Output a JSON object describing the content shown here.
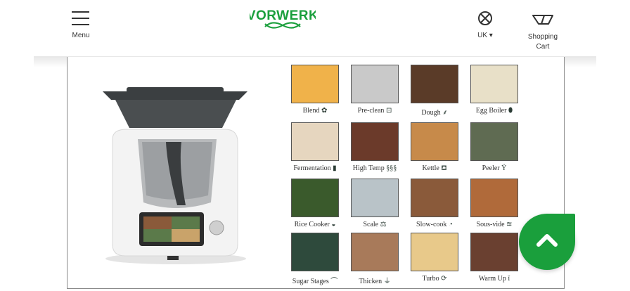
{
  "header": {
    "menu_label": "Menu",
    "logo_text": "VORWERK",
    "country_label": "UK ▾",
    "cart_label_line1": "Shopping",
    "cart_label_line2": "Cart"
  },
  "colors": {
    "brand_green": "#1a9f3c"
  },
  "tiles": [
    {
      "label": "Blend",
      "icon": "blend-icon",
      "glyph": "✿",
      "bg": "#f0b24a"
    },
    {
      "label": "Pre-clean",
      "icon": "pre-clean-icon",
      "glyph": "⊡",
      "bg": "#c9c9c9"
    },
    {
      "label": "Dough",
      "icon": "dough-icon",
      "glyph": "⸙",
      "bg": "#5a3b28"
    },
    {
      "label": "Egg Boiler",
      "icon": "egg-boiler-icon",
      "glyph": "⬮",
      "bg": "#e8e0c8"
    },
    {
      "label": "Fermentation",
      "icon": "fermentation-icon",
      "glyph": "▮",
      "bg": "#e6d6bf"
    },
    {
      "label": "High Temp",
      "icon": "high-temp-icon",
      "glyph": "§§§",
      "bg": "#6b3a2a"
    },
    {
      "label": "Kettle",
      "icon": "kettle-icon",
      "glyph": "⛾",
      "bg": "#c78a4a"
    },
    {
      "label": "Peeler",
      "icon": "peeler-icon",
      "glyph": "Ÿ",
      "bg": "#5f6b52"
    },
    {
      "label": "Rice Cooker",
      "icon": "rice-cooker-icon",
      "glyph": "◒",
      "bg": "#3a5a2c"
    },
    {
      "label": "Scale",
      "icon": "scale-icon",
      "glyph": "⚖",
      "bg": "#b9c3c8"
    },
    {
      "label": "Slow-cook",
      "icon": "slow-cook-icon",
      "glyph": "◔",
      "bg": "#8a5a3a"
    },
    {
      "label": "Sous-vide",
      "icon": "sous-vide-icon",
      "glyph": "≋",
      "bg": "#b06a3a"
    },
    {
      "label": "Sugar Stages",
      "icon": "sugar-stages-icon",
      "glyph": "⌒",
      "bg": "#2e4a3c"
    },
    {
      "label": "Thicken",
      "icon": "thicken-icon",
      "glyph": "⏚",
      "bg": "#a87a5a"
    },
    {
      "label": "Turbo",
      "icon": "turbo-icon",
      "glyph": "⟳",
      "bg": "#e8c98a"
    },
    {
      "label": "Warm Up",
      "icon": "warm-up-icon",
      "glyph": "ǐ",
      "bg": "#6a4030"
    }
  ]
}
